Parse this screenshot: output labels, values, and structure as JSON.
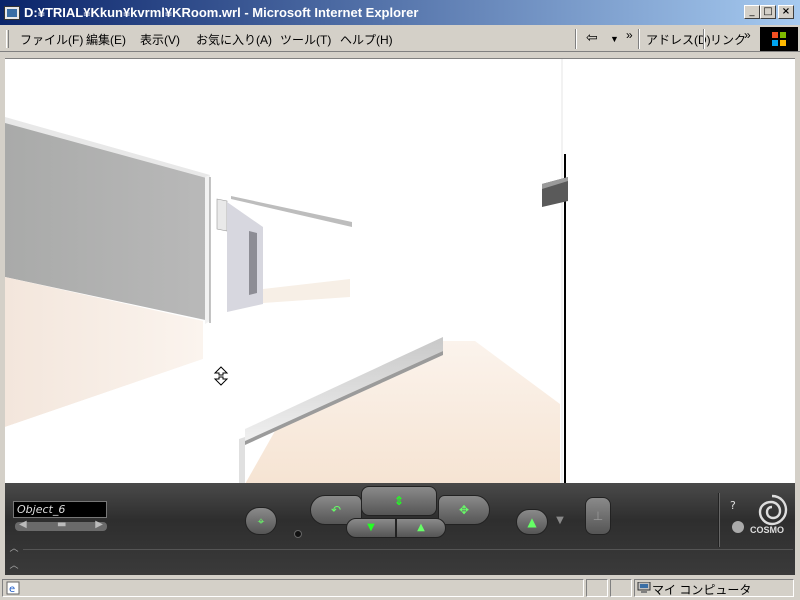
{
  "window": {
    "title": "D:¥TRIAL¥Kkun¥kvrml¥KRoom.wrl - Microsoft Internet Explorer"
  },
  "menubar": {
    "items": [
      {
        "label": "ファイル(F)"
      },
      {
        "label": "編集(E)"
      },
      {
        "label": "表示(V)"
      },
      {
        "label": "お気に入り(A)"
      },
      {
        "label": "ツール(T)"
      },
      {
        "label": "ヘルプ(H)"
      }
    ],
    "more_chevron": "»",
    "address_label": "アドレス(D)",
    "links_label": "リンク"
  },
  "viewer": {
    "object_name": "Object_6",
    "brand": "COSMO",
    "help_glyph": "?"
  },
  "statusbar": {
    "zone": "マイ コンピュータ"
  },
  "colors": {
    "title_start": "#0a246a",
    "title_end": "#a6caf0",
    "chrome": "#d4d0c8",
    "panel": "#3a3a3a",
    "control_green": "#33ff33"
  }
}
